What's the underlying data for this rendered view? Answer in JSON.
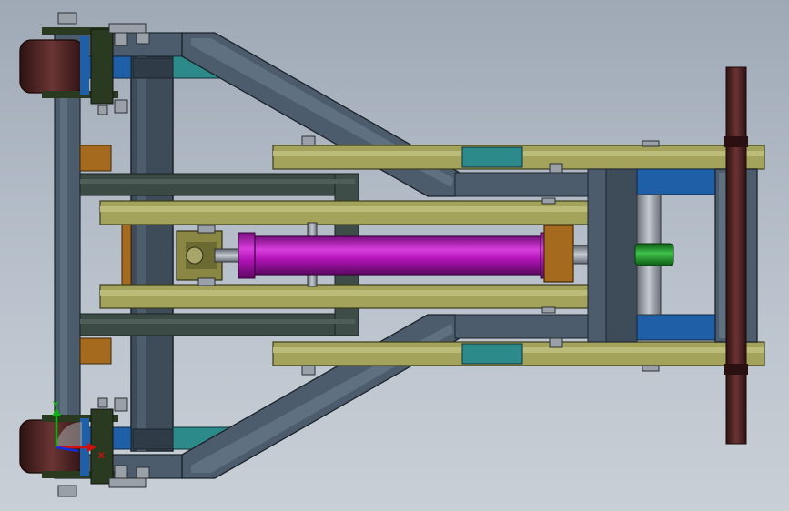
{
  "viewport": {
    "background_top": "#9fa9b6",
    "background_bottom": "#c9cfd6"
  },
  "model": {
    "colors": {
      "frame_steel": "#4c5c6c",
      "frame_dark": "#2f3b46",
      "olive_rail": "#a3a35c",
      "olive_dark": "#5e5e2c",
      "teal_plate": "#2d8a8a",
      "blue_block": "#1f5fa8",
      "cylinder_purple": "#b013b6",
      "cylinder_dark": "#6d0a72",
      "bronze_bushing": "#a66a1e",
      "wheel_brown": "#4b2222",
      "hub_green": "#1e8c2a",
      "bolt_grey": "#9aa0a8"
    },
    "parts": [
      "left-wheel-top",
      "left-wheel-bottom",
      "front-crossbeam",
      "angled-strut-upper",
      "angled-strut-lower",
      "olive-guide-rails",
      "hydraulic-cylinder",
      "rear-cart",
      "rear-wheel-axle"
    ]
  },
  "triad": {
    "x_label": "X",
    "y_label": "Y",
    "x_color": "#d01010",
    "y_color": "#10b010",
    "z_color": "#1030e0"
  }
}
